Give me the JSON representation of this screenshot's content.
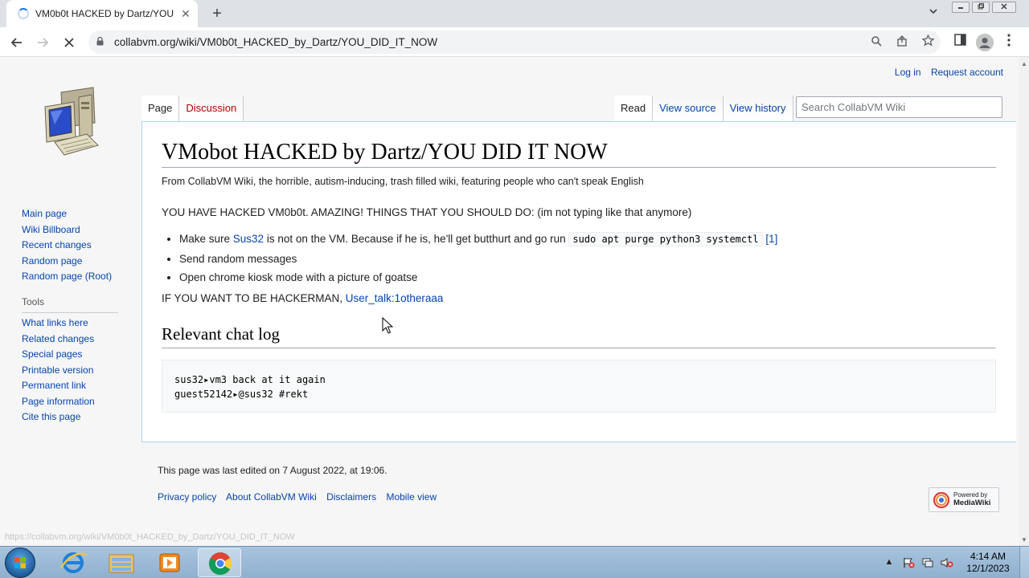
{
  "browser": {
    "tab_title": "VM0b0t HACKED by Dartz/YOU DID IT NOW",
    "url": "collabvm.org/wiki/VM0b0t_HACKED_by_Dartz/YOU_DID_IT_NOW",
    "status_url": "https://collabvm.org/wiki/VM0b0t_HACKED_by_Dartz/YOU_DID_IT_NOW",
    "new_tab_symbol": "+",
    "close_symbol": "✕"
  },
  "personal": {
    "login": "Log in",
    "request_account": "Request account"
  },
  "tabs": {
    "page": "Page",
    "discussion": "Discussion",
    "read": "Read",
    "view_source": "View source",
    "view_history": "View history"
  },
  "search": {
    "placeholder": "Search CollabVM Wiki"
  },
  "sidebar": {
    "nav": [
      "Main page",
      "Wiki Billboard",
      "Recent changes",
      "Random page",
      "Random page (Root)"
    ],
    "tools_heading": "Tools",
    "tools": [
      "What links here",
      "Related changes",
      "Special pages",
      "Printable version",
      "Permanent link",
      "Page information",
      "Cite this page"
    ]
  },
  "article": {
    "title": "VMobot HACKED by Dartz/YOU DID IT NOW",
    "site_sub": "From CollabVM Wiki, the horrible, autism-inducing, trash filled wiki, featuring people who can't speak English",
    "intro": "YOU HAVE HACKED VM0b0t. AMAZING! THINGS THAT YOU SHOULD DO: (im not typing like that anymore)",
    "bullet1_pre": "Make sure ",
    "bullet1_link": "Sus32",
    "bullet1_mid": " is not on the VM. Because if he is, he'll get butthurt and go run ",
    "bullet1_code": "sudo apt purge python3 systemctl",
    "bullet1_ref": "[1]",
    "bullet2": "Send random messages",
    "bullet3": "Open chrome kiosk mode with a picture of goatse",
    "hacker_text": "IF YOU WANT TO BE HACKERMAN, ",
    "hacker_link": "User_talk:1otheraaa",
    "section_heading": "Relevant chat log",
    "chat_log_line1": "sus32▸vm3 back at it again",
    "chat_log_line2": "guest52142▸@sus32 #rekt"
  },
  "footer": {
    "last_edited": "This page was last edited on 7 August 2022, at 19:06.",
    "links": [
      "Privacy policy",
      "About CollabVM Wiki",
      "Disclaimers",
      "Mobile view"
    ],
    "powered_by_line1": "Powered by",
    "powered_by_line2": "MediaWiki"
  },
  "taskbar": {
    "time": "4:14 AM",
    "date": "12/1/2023",
    "tray_chevron": "▲"
  },
  "colors": {
    "link": "#0645ad",
    "new_link": "#ba0000",
    "border_blue": "#a7d7f9",
    "chrome_tabbar": "#dee1e6"
  }
}
